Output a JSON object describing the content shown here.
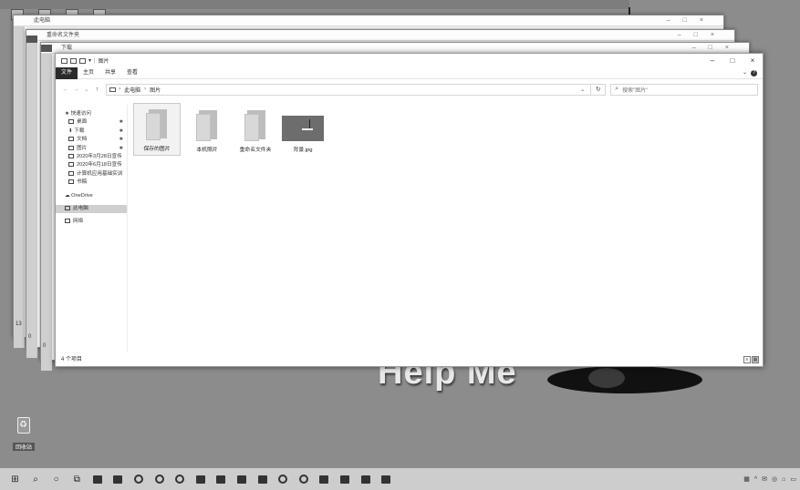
{
  "desktop": {
    "wallpaper_text": "Help  Me",
    "recycle_label": "回收站"
  },
  "background_windows": [
    {
      "title": "此电脑",
      "controls": [
        "–",
        "□",
        "×"
      ]
    },
    {
      "title": "重命名文件夹",
      "controls": [
        "–",
        "□",
        "×"
      ]
    },
    {
      "title": "下载",
      "controls": [
        "–",
        "□",
        "×"
      ]
    }
  ],
  "edge_numbers": [
    "13",
    "0",
    "0"
  ],
  "window": {
    "title": "图片",
    "controls": {
      "minimize": "–",
      "maximize": "□",
      "close": "×"
    },
    "ribbon": {
      "tabs": [
        "文件",
        "主页",
        "共享",
        "查看"
      ],
      "expand": "⌄",
      "help": "?"
    },
    "nav_buttons": {
      "back": "←",
      "forward": "→",
      "recent": "⌄",
      "up": "↑"
    },
    "address": {
      "crumbs": [
        "此电脑",
        "图片"
      ],
      "separator": "›",
      "dropdown": "⌄",
      "refresh": "↻"
    },
    "search": {
      "icon": "⌕",
      "placeholder": "搜索\"图片\""
    },
    "sidebar": {
      "quick_access_label": "快速访问",
      "items": [
        {
          "label": "桌面",
          "pinned": true
        },
        {
          "label": "下载",
          "pinned": true
        },
        {
          "label": "文档",
          "pinned": true
        },
        {
          "label": "图片",
          "pinned": true
        },
        {
          "label": "2020年3月28日宣传",
          "pinned": false
        },
        {
          "label": "2020年6月18日宣传",
          "pinned": false
        },
        {
          "label": "计算机应用基础实训",
          "pinned": false
        },
        {
          "label": "书稿",
          "pinned": false
        }
      ],
      "pin_glyph": "✱",
      "onedrive_label": "OneDrive",
      "thispc_label": "此电脑",
      "network_label": "网络"
    },
    "files": [
      {
        "name": "保存的图片",
        "type": "folder",
        "selected": true
      },
      {
        "name": "本机照片",
        "type": "folder",
        "selected": false
      },
      {
        "name": "重命名文件夹",
        "type": "folder",
        "selected": false
      },
      {
        "name": "背景.jpg",
        "type": "image",
        "selected": false
      }
    ],
    "status": {
      "item_count": "4 个项目",
      "view_details": "≡",
      "view_icons": "▦"
    }
  },
  "taskbar": {
    "icons": [
      "start-icon",
      "search-icon",
      "cortana-icon",
      "task-view-icon",
      "app-icon",
      "file-explorer-icon",
      "chrome-icon",
      "browser-icon",
      "browser2-icon",
      "word-icon",
      "photos-icon",
      "media-icon",
      "app2-icon",
      "app3-icon",
      "edge-icon",
      "app4-icon",
      "app5-icon",
      "app6-icon",
      "photoshop-icon"
    ],
    "start_glyph": "⊞",
    "search_glyph": "⌕",
    "cortana_glyph": "○",
    "taskview_glyph": "⧉",
    "tray": [
      "▦",
      "^",
      "✉",
      "◎",
      "⌂",
      "▭"
    ]
  }
}
